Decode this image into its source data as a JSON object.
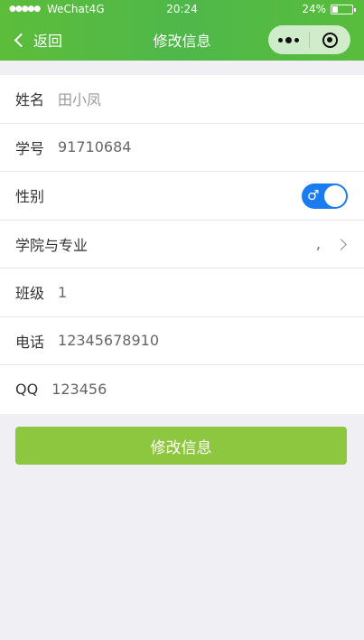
{
  "status_bar": {
    "signal": "●●●●●",
    "carrier": "WeChat4G",
    "time": "20:24",
    "battery": "24%"
  },
  "nav": {
    "back_label": "返回",
    "title": "修改信息"
  },
  "form": {
    "name": {
      "label": "姓名",
      "placeholder": "田小凤"
    },
    "student_id": {
      "label": "学号",
      "value": "91710684"
    },
    "gender": {
      "label": "性别",
      "switch_glyph": "♂",
      "switch_on": true
    },
    "major": {
      "label": "学院与专业",
      "value": ","
    },
    "class": {
      "label": "班级",
      "value": "1"
    },
    "phone": {
      "label": "电话",
      "value": "12345678910"
    },
    "qq": {
      "label": "QQ",
      "value": "123456"
    }
  },
  "submit_label": "修改信息",
  "colors": {
    "nav_green": "#52ba42",
    "switch_blue": "#1a7cf0",
    "button_green": "#8dc63f"
  }
}
